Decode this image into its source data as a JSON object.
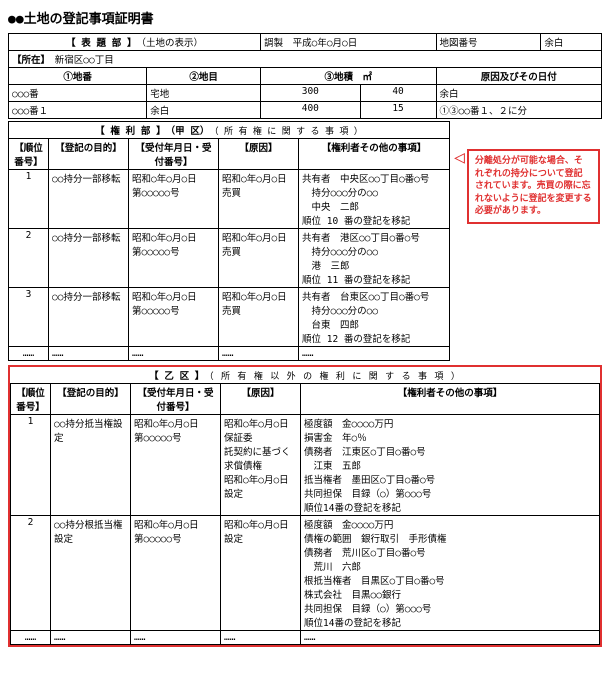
{
  "title": "●土地の登記事項証明書",
  "hyodaibu": {
    "label": "【 表 題 部 】",
    "sublabel": "（土地の表示）",
    "chosei": "調製",
    "choseiValue": "平成○年○月○日",
    "tizuBango": "地図番号",
    "余白1": "余白",
    "rows": [
      {
        "cols": [
          {
            "label": "【所在】",
            "value": "新宿区○○丁目"
          },
          {
            "label": "",
            "value": ""
          },
          {
            "label": "",
            "value": ""
          },
          {
            "label": "余白",
            "value": ""
          }
        ]
      },
      {
        "cols": [
          {
            "label": "①地番",
            "value": ""
          },
          {
            "label": "②地目",
            "value": ""
          },
          {
            "label": "③地積　㎡",
            "value": ""
          },
          {
            "label": "原因及び○の日付",
            "value": ""
          }
        ]
      },
      {
        "dataRows": [
          [
            "○○○番",
            "宅地",
            "300",
            "40",
            "余白"
          ],
          [
            "○○○番１",
            "余白",
            "400",
            "15",
            "①③○○番１、２に分"
          ]
        ]
      }
    ]
  },
  "annotation": {
    "text": "分離処分が可能な場合、そ\nれぞれの持分について登記\nされています。売買の際に忘\nれないように登記を変更する\n必要があります。"
  },
  "kenribu": {
    "label": "【 権 利 部 】",
    "sublabel_ko": "（甲 区）",
    "sublabel_ko2": "（ 所 有 権 に 関 す る 事 項 ）",
    "headers": [
      "【順位番号】",
      "【登記の目的】",
      "【受付年月日・受付番号】",
      "【原因】",
      "【権利者その他の事項】"
    ],
    "rows": [
      {
        "junni": "1",
        "mokuteki": "○○持分一部移転",
        "uketsuke": "昭和○年○月○日\n第○○○○○号",
        "genin": "昭和○年○月○日売買",
        "sono_hoka": "共有者　中央区○○丁目○番○号\n　持分○○○分の○○\n　中央　二郎\n順位 10 番の登記を移記"
      },
      {
        "junni": "2",
        "mokuteki": "○○持分一部移転",
        "uketsuke": "昭和○年○月○日\n第○○○○○号",
        "genin": "昭和○年○月○日売買",
        "sono_hoka": "共有者　港区○○丁目○番○号\n　持分○○○分の○○\n　港　三郎\n順位 11 番の登記を移記"
      },
      {
        "junni": "3",
        "mokuteki": "○○持分一部移転",
        "uketsuke": "昭和○年○月○日\n第○○○○○号",
        "genin": "昭和○年○月○日売買",
        "sono_hoka": "共有者　台東区○○丁目○番○号\n　持分○○○分の○○\n　台東　四郎\n順位 12 番の登記を移記"
      },
      {
        "junni": "……",
        "mokuteki": "……",
        "uketsuke": "……",
        "genin": "……",
        "sono_hoka": "……"
      }
    ]
  },
  "otsubu": {
    "label": "【 乙 区 】",
    "sublabel": "（ 所 有 権 以 外 の 権 利 に 関 す る 事 項 ）",
    "headers": [
      "【順位番号】",
      "【登記の目的】",
      "【受付年月日・受付番号】",
      "【原因】",
      "【権利者その他の事項】"
    ],
    "rows": [
      {
        "junni": "1",
        "mokuteki": "○○持分抵当権設定",
        "uketsuke": "昭和○年○月○日\n第○○○○○号",
        "genin": "昭和○年○月○日保証委\n託契約に基づく求償債権\n昭和○年○月○日設定",
        "sono_hoka": "極度額　金○○○○万円\n損害金　年○％\n債務者　江東区○丁目○番○号\n　江東　五郎\n抵当権者　墨田区○丁目○番○号\n共同担保　目録（○）第○○○号\n順位14番の登記を移記",
        "highlight": true
      },
      {
        "junni": "2",
        "mokuteki": "○○持分根抵当権設定",
        "uketsuke": "昭和○年○月○日\n第○○○○○号",
        "genin": "昭和○年○月○日設定",
        "sono_hoka": "極度額　金○○○○万円\n債権の範囲　銀行取引　手形債権\n債務者　荒川区○丁目○番○号\n　荒川　六郎\n根抵当権者　目黒区○丁目○番○号\n株式会社　目黒○○銀行\n共同担保　目録（○）第○○○号\n順位14番の登記を移記"
      },
      {
        "junni": "……",
        "mokuteki": "……",
        "uketsuke": "……",
        "genin": "……",
        "sono_hoka": "……"
      }
    ]
  }
}
